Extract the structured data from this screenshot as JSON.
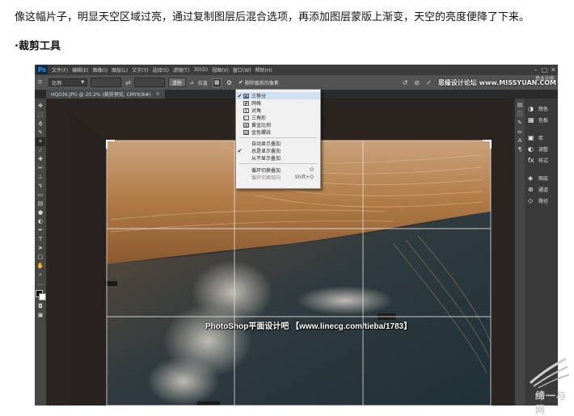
{
  "article": {
    "paragraph": "像这幅片子，明显天空区域过亮，通过复制图层后混合选项，再添加图层蒙版上渐变，天空的亮度便降了下来。",
    "heading": "·裁剪工具"
  },
  "app": {
    "logo": "Ps",
    "menu": [
      "文件(F)",
      "编辑(E)",
      "图像(I)",
      "图层(L)",
      "文字(Y)",
      "选择(S)",
      "滤镜(T)",
      "3D(D)",
      "视图(V)",
      "窗口(W)",
      "帮助(H)"
    ],
    "window_controls": [
      "–",
      "□",
      "✕"
    ],
    "watermark_top": "思缘设计论坛 www.MISSYUAN.COM",
    "workspace": "基本功能"
  },
  "options_bar": {
    "tool_icon": "crop-icon",
    "ratio_value": "比例",
    "clear_button": "清除",
    "straighten_label": "拉直",
    "delete_cropped_label": "删除裁剪的像素",
    "delete_cropped_checked": true
  },
  "document": {
    "tab_title": "HQ036.JPG @ 20.2% (裁剪预览, CMYK/8#)"
  },
  "overlay_menu": {
    "items": [
      {
        "label": "三等分",
        "checked": true,
        "icon": "rule-of-thirds-icon"
      },
      {
        "label": "网格",
        "checked": false,
        "icon": "grid-icon"
      },
      {
        "label": "对角",
        "checked": false,
        "icon": "diagonal-icon"
      },
      {
        "label": "三角形",
        "checked": false,
        "icon": "triangle-icon"
      },
      {
        "label": "黄金比例",
        "checked": false,
        "icon": "golden-ratio-icon"
      },
      {
        "label": "金色螺线",
        "checked": false,
        "icon": "golden-spiral-icon"
      }
    ],
    "display_items": [
      {
        "label": "自动显示叠加",
        "checked": false
      },
      {
        "label": "总是显示叠加",
        "checked": true
      },
      {
        "label": "从不显示叠加",
        "checked": false
      }
    ],
    "cycle_items": [
      {
        "label": "循环切换叠加",
        "shortcut": "O",
        "disabled": false
      },
      {
        "label": "循环切换取向",
        "shortcut": "Shift+O",
        "disabled": true
      }
    ]
  },
  "panels": [
    {
      "label": "颜色",
      "icon": "color-icon"
    },
    {
      "label": "色板",
      "icon": "swatches-icon"
    },
    {
      "label": "库",
      "icon": "library-icon"
    },
    {
      "label": "调整",
      "icon": "adjustments-icon"
    },
    {
      "label": "样式",
      "icon": "styles-icon"
    },
    {
      "label": "图层",
      "icon": "layers-icon"
    },
    {
      "label": "通道",
      "icon": "channels-icon"
    },
    {
      "label": "路径",
      "icon": "paths-icon"
    }
  ],
  "footer_banner": "PhotoShop平面设计吧 【www.linecg.com/tieba/1783】",
  "corner_logo": "缔一与网"
}
